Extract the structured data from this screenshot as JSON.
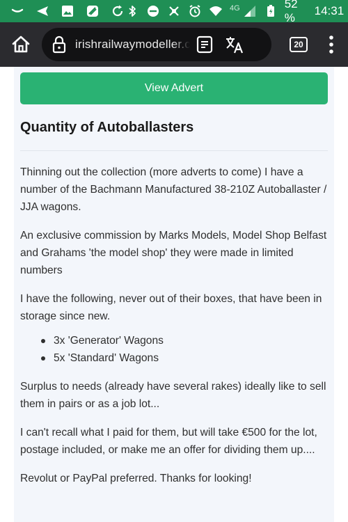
{
  "status_bar": {
    "network": "4G",
    "battery": "52 %",
    "time": "14:31"
  },
  "browser": {
    "url": "irishrailwaymodeller.com",
    "tab_count": "20"
  },
  "advert": {
    "view_button": "View Advert",
    "title": "Quantity of Autoballasters",
    "paragraphs": [
      "Thinning out the collection (more adverts to come) I have a number of the Bachmann Manufactured 38-210Z Autoballaster / JJA wagons.",
      "An exclusive commission by Marks Models, Model Shop Belfast and Grahams 'the model shop' they were made in limited numbers",
      "I have the following, never out of their boxes, that have been in storage since new."
    ],
    "list_items": [
      "3x 'Generator' Wagons",
      "5x 'Standard' Wagons"
    ],
    "paragraphs_after": [
      "Surplus to needs (already have several rakes) ideally like to sell them in pairs or as a job lot...",
      "I can't recall what I paid for them, but will take €500 for the lot, postage included, or make me an offer for dividing them up....",
      "Revolut or PayPal preferred. Thanks for looking!"
    ]
  }
}
